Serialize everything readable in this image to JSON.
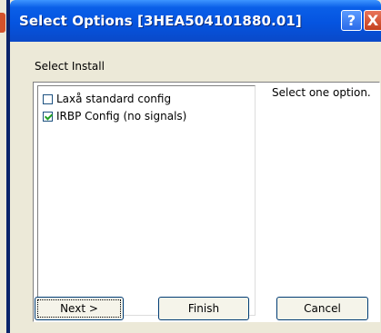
{
  "window": {
    "title": "Select Options [3HEA504101880.01]"
  },
  "titlebar_buttons": {
    "help": "?",
    "close": "X"
  },
  "section": {
    "label": "Select Install"
  },
  "options": [
    {
      "label": "Laxå standard config",
      "checked": false
    },
    {
      "label": "IRBP Config (no signals)",
      "checked": true
    }
  ],
  "hint": "Select one option.",
  "buttons": {
    "next": "Next >",
    "finish": "Finish",
    "cancel": "Cancel"
  },
  "colors": {
    "titlebar": "#0554e0",
    "dialog_bg": "#ece9d8",
    "close_button": "#c4401e"
  }
}
